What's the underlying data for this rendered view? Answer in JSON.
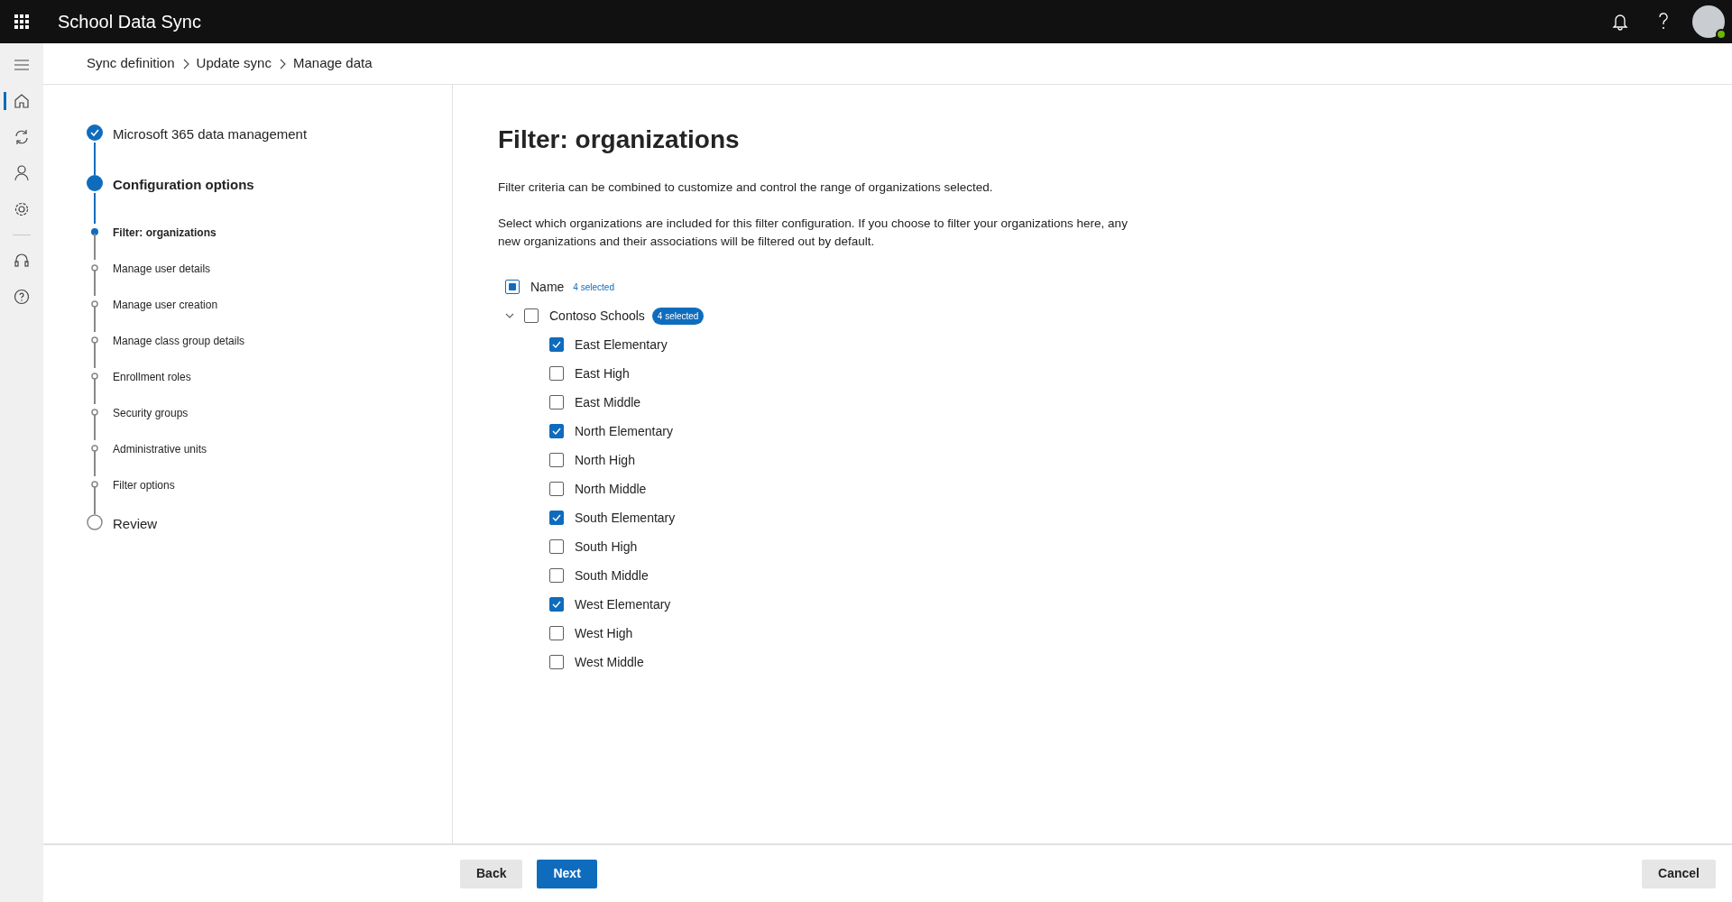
{
  "app": {
    "title": "School Data Sync"
  },
  "breadcrumb": [
    {
      "label": "Sync definition"
    },
    {
      "label": "Update sync"
    },
    {
      "label": "Manage data"
    }
  ],
  "steps": [
    {
      "kind": "step",
      "label": "Microsoft 365 data management",
      "completed": true,
      "selected": false
    },
    {
      "kind": "step",
      "label": "Configuration options",
      "completed": false,
      "selected": true
    },
    {
      "kind": "substep",
      "label": "Filter: organizations",
      "completed": false,
      "selected": true
    },
    {
      "kind": "substep",
      "label": "Manage user details",
      "completed": false,
      "selected": false
    },
    {
      "kind": "substep",
      "label": "Manage user creation",
      "completed": false,
      "selected": false
    },
    {
      "kind": "substep",
      "label": "Manage class group details",
      "completed": false,
      "selected": false
    },
    {
      "kind": "substep",
      "label": "Enrollment roles",
      "completed": false,
      "selected": false
    },
    {
      "kind": "substep",
      "label": "Security groups",
      "completed": false,
      "selected": false
    },
    {
      "kind": "substep",
      "label": "Administrative units",
      "completed": false,
      "selected": false
    },
    {
      "kind": "substep",
      "label": "Filter options",
      "completed": false,
      "selected": false
    },
    {
      "kind": "step",
      "label": "Review",
      "completed": false,
      "selected": false
    }
  ],
  "content": {
    "title": "Filter: organizations",
    "paragraphs": [
      "Filter criteria can be combined to customize and control the range of organizations selected.",
      "Select which organizations are included for this filter configuration. If you choose to filter your organizations here, any new organizations and their associations will be filtered out by default."
    ],
    "header": {
      "label": "Name",
      "count": "4 selected",
      "partial": true
    },
    "group": {
      "label": "Contoso Schools",
      "badge": "4 selected",
      "checked": false,
      "expanded": true,
      "items": [
        {
          "label": "East Elementary",
          "checked": true
        },
        {
          "label": "East High",
          "checked": false
        },
        {
          "label": "East Middle",
          "checked": false
        },
        {
          "label": "North Elementary",
          "checked": true
        },
        {
          "label": "North High",
          "checked": false
        },
        {
          "label": "North Middle",
          "checked": false
        },
        {
          "label": "South Elementary",
          "checked": true
        },
        {
          "label": "South High",
          "checked": false
        },
        {
          "label": "South Middle",
          "checked": false
        },
        {
          "label": "West Elementary",
          "checked": true
        },
        {
          "label": "West High",
          "checked": false
        },
        {
          "label": "West Middle",
          "checked": false
        }
      ]
    }
  },
  "footer": {
    "buttons": [
      {
        "label": "Back",
        "kind": "secondary"
      },
      {
        "label": "Next",
        "kind": "primary"
      },
      {
        "label": "Cancel",
        "kind": "secondary"
      }
    ]
  }
}
